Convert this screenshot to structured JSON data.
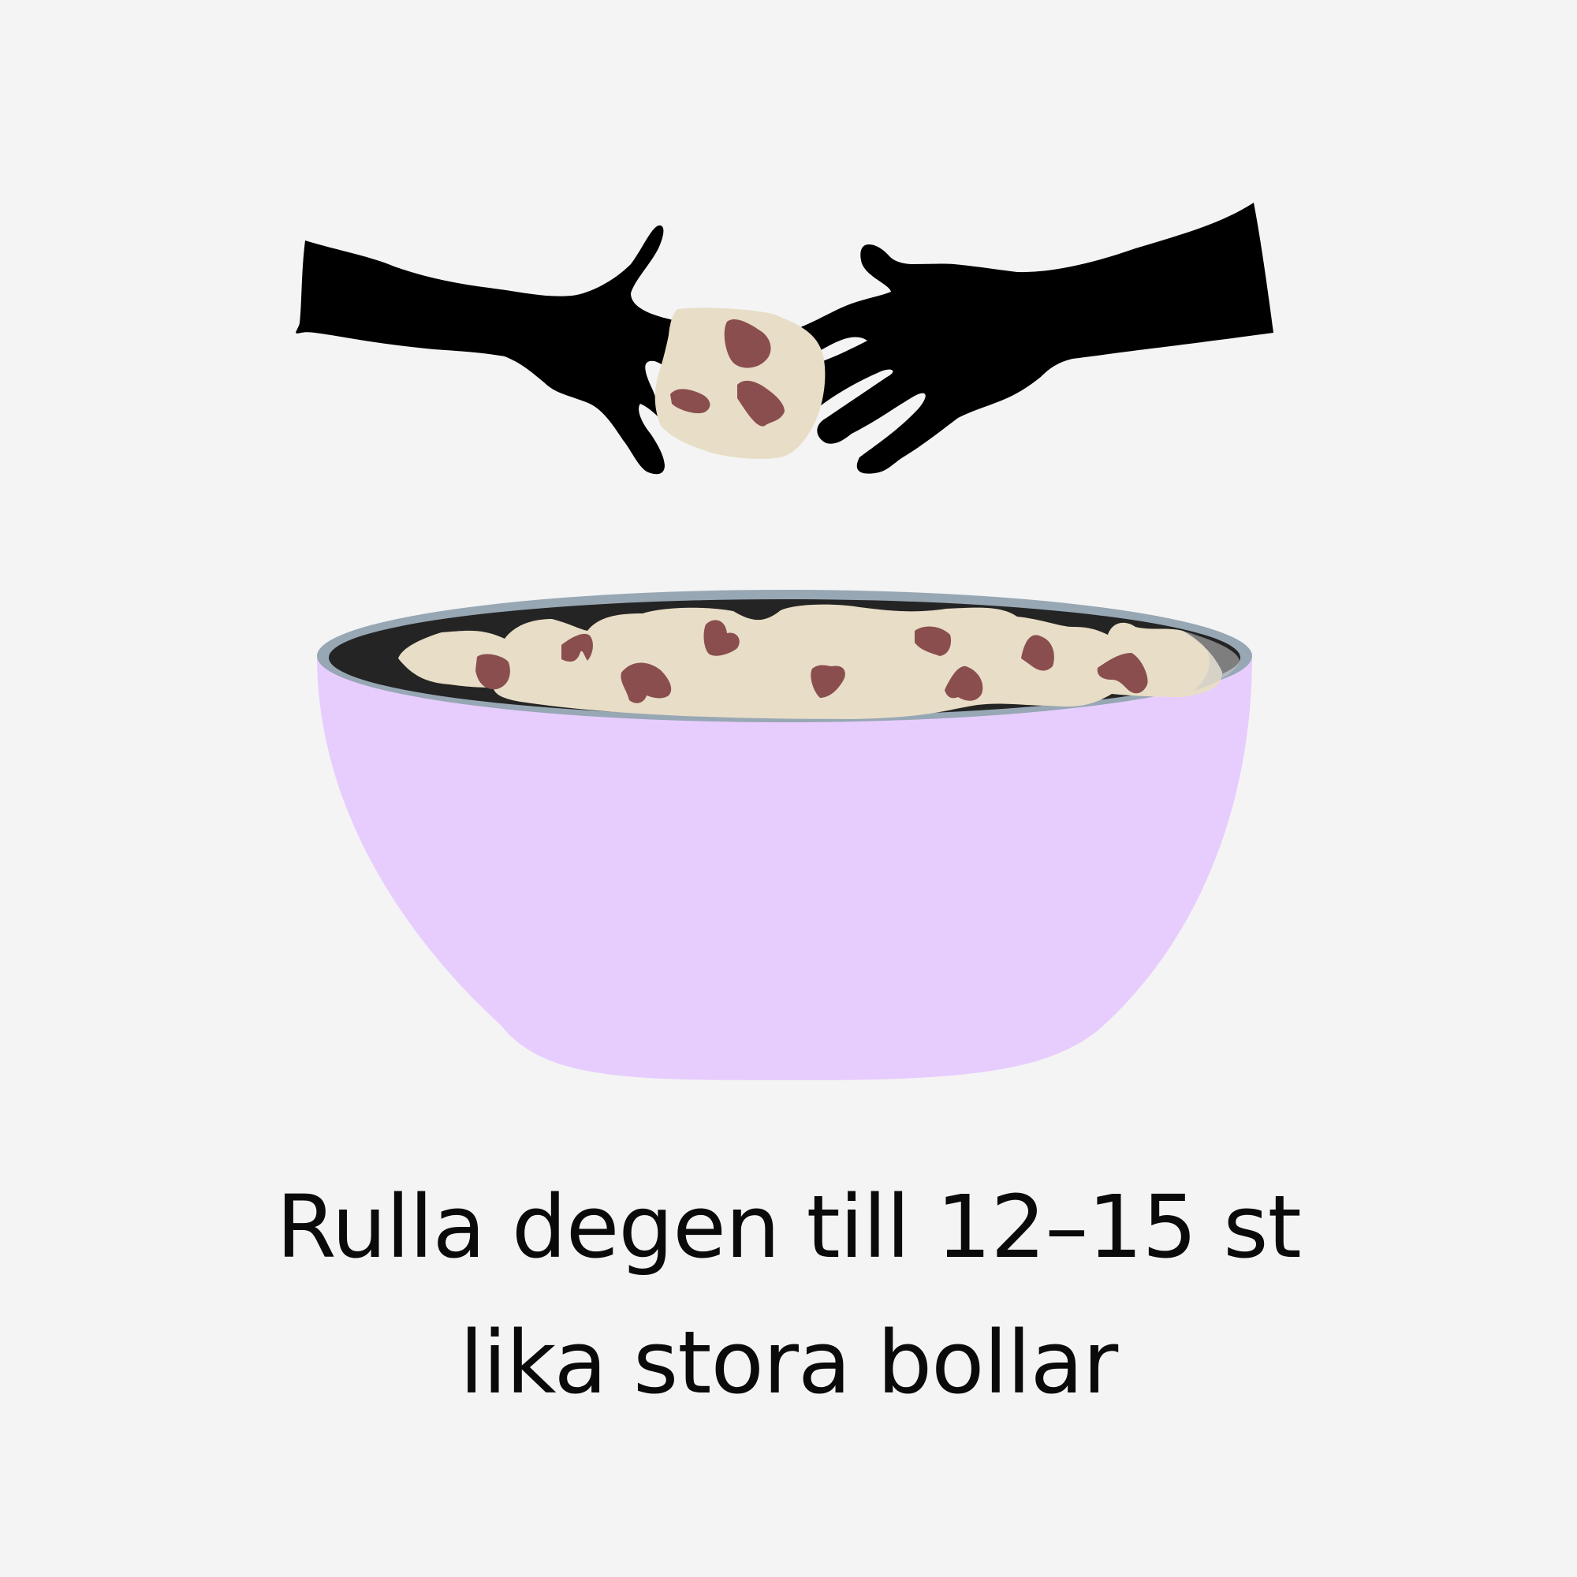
{
  "colors": {
    "background": "#f4f4f4",
    "bowl": "#e7cdfe",
    "bowl_rim": "#97a7b4",
    "bowl_inside": "#242424",
    "dough": "#e8ddc6",
    "chocolate": "#8a4e4e",
    "hands": "#000000",
    "text": "#0a0a0a"
  },
  "icons": {
    "hands": "hands-rolling-icon",
    "dough_ball": "dough-ball-icon",
    "bowl": "mixing-bowl-icon"
  },
  "caption": {
    "line1": "Rulla degen till 12–15 st",
    "line2": "lika stora bollar"
  }
}
